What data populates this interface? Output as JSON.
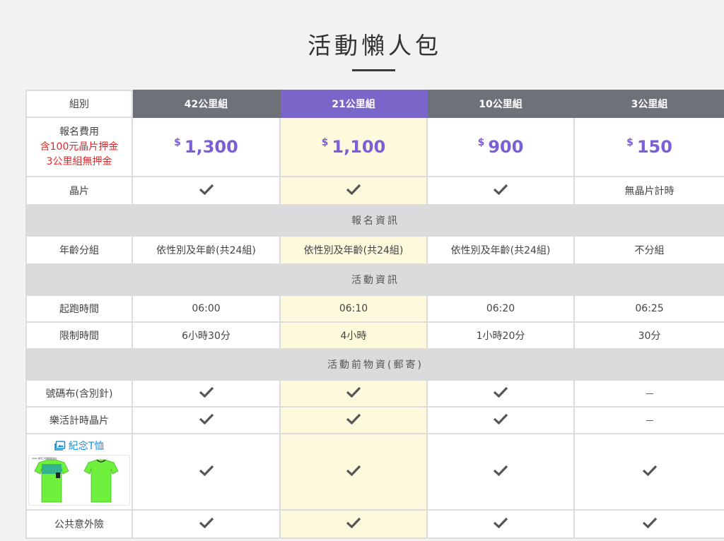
{
  "page": {
    "title": "活動懶人包"
  },
  "table": {
    "header": [
      "組別",
      "42公里組",
      "21公里組",
      "10公里組",
      "3公里組"
    ],
    "fee": {
      "label_line1": "報名費用",
      "label_line2": "含100元晶片押金",
      "label_line3": "3公里組無押金",
      "currency": "$",
      "prices": [
        "1,300",
        "1,100",
        "900",
        "150"
      ]
    },
    "chip": {
      "label": "晶片",
      "col4_text": "無晶片計時"
    },
    "sections": [
      "報名資訊",
      "活動資訊",
      "活動前物資(郵寄)"
    ],
    "age_group": {
      "label": "年齡分組",
      "values": [
        "依性別及年齡(共24組)",
        "依性別及年齡(共24組)",
        "依性別及年齡(共24組)",
        "不分組"
      ]
    },
    "start_time": {
      "label": "起跑時間",
      "values": [
        "06:00",
        "06:10",
        "06:20",
        "06:25"
      ]
    },
    "time_limit": {
      "label": "限制時間",
      "values": [
        "6小時30分",
        "4小時",
        "1小時20分",
        "30分"
      ]
    },
    "bib": {
      "label": "號碼布(含別針)"
    },
    "timing_chip": {
      "label": "樂活計時晶片"
    },
    "tshirt": {
      "label": "紀念T恤",
      "image_caption": "2021 臺灣三宅路跑紀念衫"
    },
    "insurance": {
      "label": "公共意外險"
    }
  },
  "icons": {
    "check": "check-icon",
    "dash": "dash-icon",
    "image": "image-icon"
  },
  "colors": {
    "header_gray": "#6d7278",
    "featured_purple": "#7a66c8",
    "price_purple": "#7a5fd6",
    "highlight": "#fcf9dc",
    "section_gray": "#dadbdd",
    "red_note": "#e02a2a",
    "link_blue": "#1a8fd6",
    "shirt_green": "#6ef03c"
  }
}
